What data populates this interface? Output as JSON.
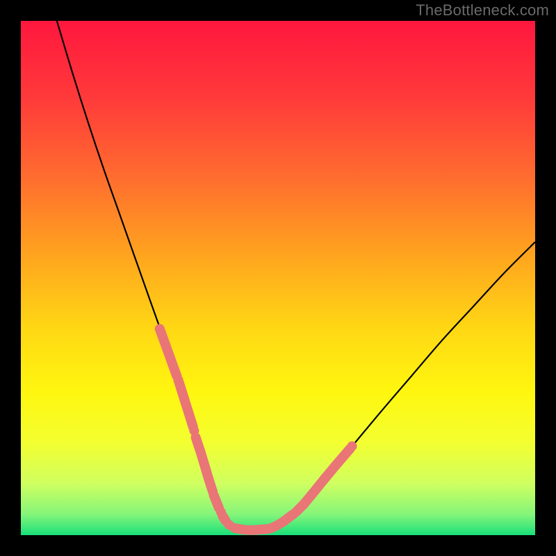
{
  "credit": "TheBottleneck.com",
  "chart_data": {
    "type": "line",
    "title": "",
    "xlabel": "",
    "ylabel": "",
    "xlim": [
      0,
      100
    ],
    "ylim": [
      0,
      100
    ],
    "grid": false,
    "legend": false,
    "series": [
      {
        "name": "curve",
        "x": [
          7,
          10,
          13,
          16,
          19,
          22,
          25,
          27.5,
          30,
          32,
          33.5,
          35,
          36.5,
          38,
          39,
          40,
          42,
          45,
          48,
          52,
          56,
          60,
          65,
          70,
          76,
          82,
          88,
          94,
          100
        ],
        "y": [
          100,
          90,
          80.5,
          71.5,
          63,
          54.5,
          46,
          39,
          32,
          26,
          21,
          16,
          11,
          7,
          4.5,
          2.5,
          1.2,
          1.0,
          1.2,
          3,
          7,
          12,
          18,
          24,
          31,
          38,
          44.5,
          51,
          57
        ]
      }
    ],
    "highlight_segments": [
      {
        "x0": 27.0,
        "y0": 40.1,
        "x1": 30.3,
        "y1": 31.0
      },
      {
        "x0": 30.6,
        "y0": 30.2,
        "x1": 33.5,
        "y1": 21.0
      },
      {
        "x0": 34.0,
        "y0": 19.0,
        "x1": 35.0,
        "y1": 16.0
      },
      {
        "x0": 35.0,
        "y0": 16.0,
        "x1": 36.5,
        "y1": 11.0
      },
      {
        "x0": 36.5,
        "y0": 11.0,
        "x1": 37.2,
        "y1": 8.8
      },
      {
        "x0": 37.5,
        "y0": 7.8,
        "x1": 38.5,
        "y1": 5.3
      },
      {
        "x0": 39.2,
        "y0": 3.8,
        "x1": 39.8,
        "y1": 2.8
      },
      {
        "x0": 41.5,
        "y0": 1.4,
        "x1": 43.0,
        "y1": 1.1
      },
      {
        "x0": 44.0,
        "y0": 1.0,
        "x1": 45.5,
        "y1": 1.0
      },
      {
        "x0": 46.0,
        "y0": 1.05,
        "x1": 48.0,
        "y1": 1.2
      },
      {
        "x0": 49.0,
        "y0": 1.5,
        "x1": 50.0,
        "y1": 2.0
      },
      {
        "x0": 51.0,
        "y0": 2.6,
        "x1": 53.0,
        "y1": 4.1
      },
      {
        "x0": 53.5,
        "y0": 4.5,
        "x1": 55.0,
        "y1": 6.0
      },
      {
        "x0": 55.0,
        "y0": 6.0,
        "x1": 56.5,
        "y1": 7.8
      },
      {
        "x0": 56.5,
        "y0": 7.8,
        "x1": 59.0,
        "y1": 10.9
      },
      {
        "x0": 59.0,
        "y0": 10.9,
        "x1": 61.0,
        "y1": 13.3
      },
      {
        "x0": 61.0,
        "y0": 13.3,
        "x1": 64.0,
        "y1": 16.8
      }
    ],
    "highlight_points": [
      {
        "x": 27.0,
        "y": 40.1
      },
      {
        "x": 30.3,
        "y": 31.0
      },
      {
        "x": 33.7,
        "y": 20.3
      },
      {
        "x": 37.3,
        "y": 8.5
      },
      {
        "x": 38.9,
        "y": 4.5
      },
      {
        "x": 40.5,
        "y": 2.0
      },
      {
        "x": 43.5,
        "y": 1.05
      },
      {
        "x": 45.7,
        "y": 1.0
      },
      {
        "x": 48.5,
        "y": 1.3
      },
      {
        "x": 50.5,
        "y": 2.3
      },
      {
        "x": 55.0,
        "y": 6.0
      },
      {
        "x": 64.4,
        "y": 17.3
      }
    ],
    "gradient_stops": [
      {
        "offset": 0.0,
        "color": "#ff173e"
      },
      {
        "offset": 0.15,
        "color": "#ff3a3a"
      },
      {
        "offset": 0.3,
        "color": "#ff6b2f"
      },
      {
        "offset": 0.45,
        "color": "#ffa21f"
      },
      {
        "offset": 0.6,
        "color": "#ffd814"
      },
      {
        "offset": 0.72,
        "color": "#fff60f"
      },
      {
        "offset": 0.82,
        "color": "#f3ff30"
      },
      {
        "offset": 0.9,
        "color": "#cfff60"
      },
      {
        "offset": 0.96,
        "color": "#84f57a"
      },
      {
        "offset": 1.0,
        "color": "#19e07a"
      }
    ],
    "colors": {
      "curve": "#000000",
      "highlight": "#e97577",
      "frame_bg": "#000000"
    }
  }
}
